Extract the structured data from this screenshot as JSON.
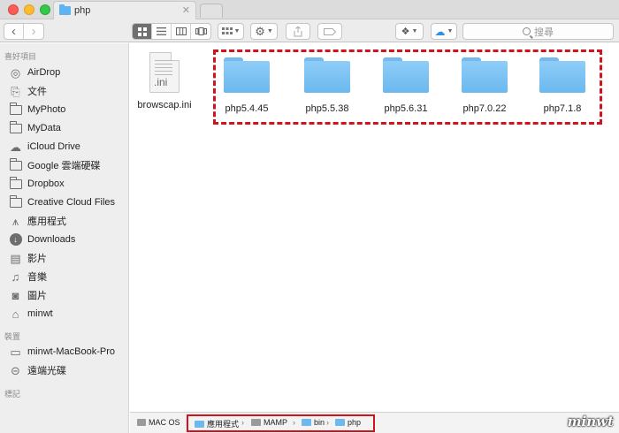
{
  "window": {
    "tab_title": "php",
    "tab_close": "✕"
  },
  "toolbar": {
    "back_icon": "‹",
    "forward_icon": "›",
    "search_placeholder": "搜尋"
  },
  "sidebar": {
    "favorites_header": "喜好項目",
    "favorites": [
      {
        "label": "AirDrop",
        "icon": "airdrop-icon"
      },
      {
        "label": "文件",
        "icon": "documents-icon"
      },
      {
        "label": "MyPhoto",
        "icon": "folder-icon"
      },
      {
        "label": "MyData",
        "icon": "folder-icon"
      },
      {
        "label": "iCloud Drive",
        "icon": "cloud-icon"
      },
      {
        "label": "Google 雲端硬碟",
        "icon": "folder-icon"
      },
      {
        "label": "Dropbox",
        "icon": "folder-icon"
      },
      {
        "label": "Creative Cloud Files",
        "icon": "folder-icon"
      },
      {
        "label": "應用程式",
        "icon": "applications-icon"
      },
      {
        "label": "Downloads",
        "icon": "downloads-icon"
      },
      {
        "label": "影片",
        "icon": "movies-icon"
      },
      {
        "label": "音樂",
        "icon": "music-icon"
      },
      {
        "label": "圖片",
        "icon": "pictures-icon"
      },
      {
        "label": "minwt",
        "icon": "home-icon"
      }
    ],
    "devices_header": "裝置",
    "devices": [
      {
        "label": "minwt-MacBook-Pro",
        "icon": "laptop-icon"
      },
      {
        "label": "遠端光碟",
        "icon": "disc-icon"
      }
    ],
    "tags_header": "標記"
  },
  "files": [
    {
      "name": "browscap.ini",
      "type": "document",
      "ext": ".ini"
    },
    {
      "name": "php5.4.45",
      "type": "folder"
    },
    {
      "name": "php5.5.38",
      "type": "folder"
    },
    {
      "name": "php5.6.31",
      "type": "folder"
    },
    {
      "name": "php7.0.22",
      "type": "folder"
    },
    {
      "name": "php7.1.8",
      "type": "folder"
    }
  ],
  "pathbar": {
    "items": [
      "MAC OS",
      "應用程式",
      "MAMP",
      "bin",
      "php"
    ],
    "separator": "›"
  },
  "watermark": "minwt",
  "colors": {
    "highlight_red": "#d1141b",
    "folder_blue": "#6bb8ef"
  }
}
